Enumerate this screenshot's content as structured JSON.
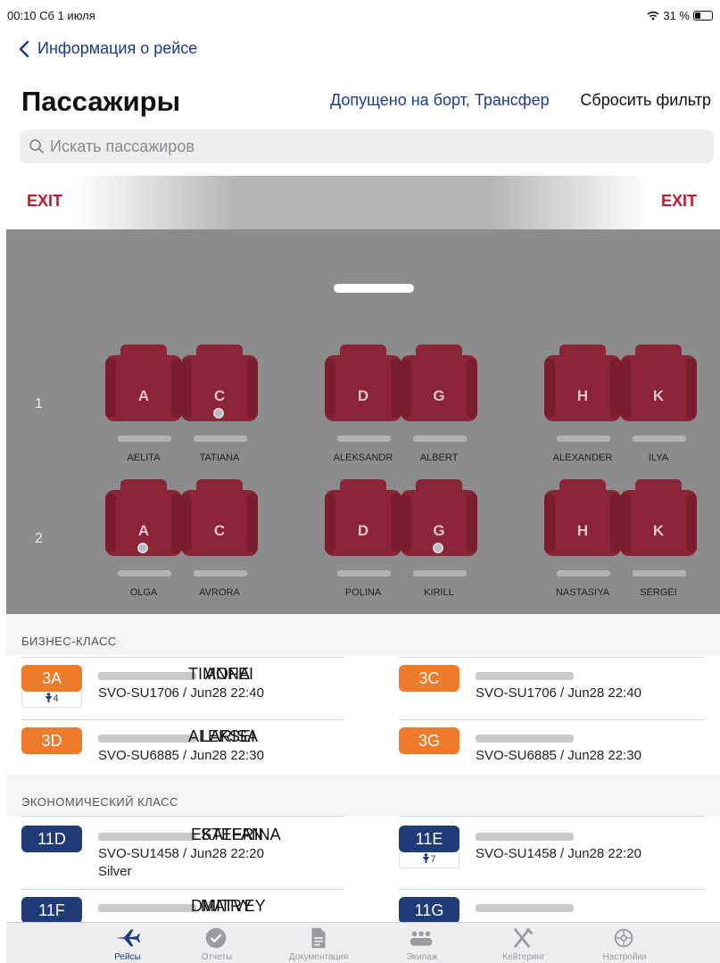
{
  "status_bar": {
    "time_date": "00:10  Сб 1 июля",
    "battery": "31 %"
  },
  "nav": {
    "back_label": "Информация о рейсе"
  },
  "header": {
    "title": "Пассажиры",
    "filter_label": "Допущено на борт, Трансфер",
    "reset_label": "Сбросить фильтр"
  },
  "search": {
    "placeholder": "Искать пассажиров"
  },
  "exits": {
    "left": "EXIT",
    "right": "EXIT"
  },
  "seat_map": {
    "rows": [
      {
        "number": "1",
        "seats": [
          {
            "letter": "A",
            "passenger": "AELITA",
            "dot": false
          },
          {
            "letter": "C",
            "passenger": "TATIANA",
            "dot": true
          },
          {
            "letter": "D",
            "passenger": "ALEKSANDR",
            "dot": false
          },
          {
            "letter": "G",
            "passenger": "ALBERT",
            "dot": false
          },
          {
            "letter": "H",
            "passenger": "ALEXANDER",
            "dot": false
          },
          {
            "letter": "K",
            "passenger": "ILYA",
            "dot": false
          }
        ]
      },
      {
        "number": "2",
        "seats": [
          {
            "letter": "A",
            "passenger": "OLGA",
            "dot": true
          },
          {
            "letter": "C",
            "passenger": "AVRORA",
            "dot": false
          },
          {
            "letter": "D",
            "passenger": "POLINA",
            "dot": false
          },
          {
            "letter": "G",
            "passenger": "KIRILL",
            "dot": true
          },
          {
            "letter": "H",
            "passenger": "NASTASIYA",
            "dot": false
          },
          {
            "letter": "K",
            "passenger": "SERGEI",
            "dot": false
          }
        ]
      }
    ]
  },
  "sections": [
    {
      "title": "БИЗНЕС-КЛАСС",
      "passengers": [
        {
          "seat": "3A",
          "name": "TIMOFEI",
          "flight": "SVO-SU1706 / Jun28 22:40",
          "extra": "4",
          "tier": ""
        },
        {
          "seat": "3C",
          "name": "ANNA",
          "flight": "SVO-SU1706 / Jun28 22:40",
          "extra": "",
          "tier": ""
        },
        {
          "seat": "3D",
          "name": "ALEKSEI",
          "flight": "SVO-SU6885 / Jun28 22:30",
          "extra": "",
          "tier": ""
        },
        {
          "seat": "3G",
          "name": "LARISA",
          "flight": "SVO-SU6885 / Jun28 22:30",
          "extra": "",
          "tier": ""
        }
      ]
    },
    {
      "title": "ЭКОНОМИЧЕСКИЙ КЛАСС",
      "passengers": [
        {
          "seat": "11D",
          "name": "EKATERINA",
          "flight": "SVO-SU1458 / Jun28 22:20",
          "extra": "",
          "tier": "Silver"
        },
        {
          "seat": "11E",
          "name": "STEFAN",
          "flight": "SVO-SU1458 / Jun28 22:20",
          "extra": "7",
          "tier": ""
        },
        {
          "seat": "11F",
          "name": "DMITRY",
          "flight": "",
          "extra": "",
          "tier": ""
        },
        {
          "seat": "11G",
          "name": "MATVEY",
          "flight": "",
          "extra": "",
          "tier": ""
        }
      ]
    }
  ],
  "tabs": [
    {
      "label": "Рейсы",
      "icon": "plane-icon",
      "active": true
    },
    {
      "label": "Отчеты",
      "icon": "check-circle-icon",
      "active": false
    },
    {
      "label": "Документация",
      "icon": "document-icon",
      "active": false
    },
    {
      "label": "Экипаж",
      "icon": "crew-icon",
      "active": false
    },
    {
      "label": "Кейтеринг",
      "icon": "fork-knife-icon",
      "active": false
    },
    {
      "label": "Настройки",
      "icon": "settings-icon",
      "active": false
    }
  ],
  "colors": {
    "brand_blue": "#1f3c78",
    "business_orange": "#ee7b2b",
    "exit_red": "#c4172e",
    "seat_red": "#8b2436"
  }
}
